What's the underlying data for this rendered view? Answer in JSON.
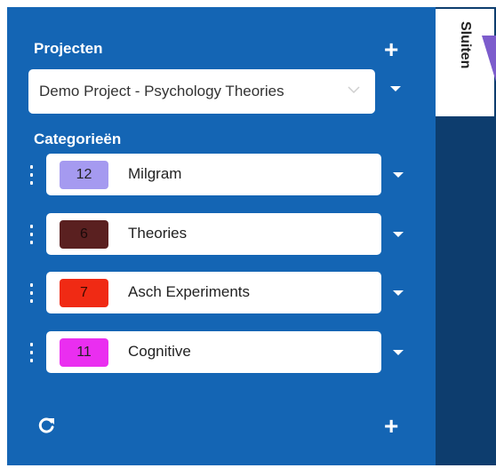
{
  "panel": {
    "projects_heading": "Projecten",
    "project_dropdown": {
      "selected": "Demo Project - Psychology Theories"
    },
    "categories_heading": "Categorieën",
    "categories": [
      {
        "count": "12",
        "name": "Milgram",
        "color": "#a59af0",
        "text_color": "#222222"
      },
      {
        "count": "6",
        "name": "Theories",
        "color": "#5a2020",
        "text_color": "#1a0a0a"
      },
      {
        "count": "7",
        "name": "Asch Experiments",
        "color": "#f02a14",
        "text_color": "#3a0a00"
      },
      {
        "count": "11",
        "name": "Cognitive",
        "color": "#ea2ef0",
        "text_color": "#222222"
      }
    ],
    "add_icon": "plus-icon",
    "refresh_icon": "refresh-icon"
  },
  "close_tab": {
    "label": "Sluiten"
  },
  "colors": {
    "panel_bg": "#1465b4",
    "background": "#0d3d6e",
    "accent_purple": "#7c5ccc"
  }
}
